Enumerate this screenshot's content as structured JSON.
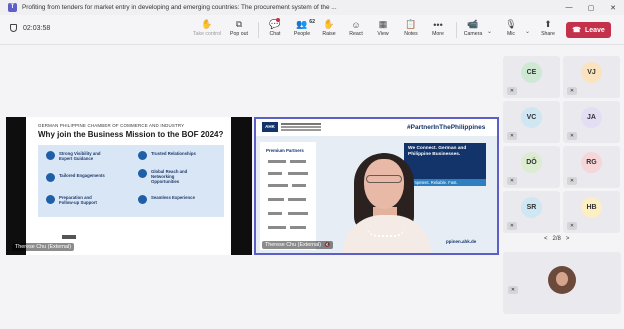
{
  "window": {
    "title": "Profiting from tenders for market entry in developing and emerging countries: The procurement system of the ...",
    "more": "...",
    "controls": [
      "—",
      "▢",
      "✕"
    ]
  },
  "toolbar": {
    "timer": "02:03:58",
    "take_control": "Take control",
    "pop_out": "Pop out",
    "chat": "Chat",
    "people": "People",
    "people_count": "62",
    "raise": "Raise",
    "react": "React",
    "view": "View",
    "notes": "Notes",
    "more": "More",
    "camera": "Camera",
    "mic": "Mic",
    "share": "Share",
    "leave": "Leave"
  },
  "left_tile": {
    "slide_org": "GERMAN PHILIPPINE CHAMBER OF COMMERCE AND INDUSTRY",
    "slide_title": "Why join the Business Mission to the BOF 2024?",
    "features": [
      "Strong Visibility and Expert Guidance",
      "Trusted Relationships",
      "Tailored Engagements",
      "Global Reach and Networking Opportunities",
      "Preparation and Follow-up Support",
      "Seamless Experience"
    ],
    "name_label": "Therese Chu (External)"
  },
  "right_tile": {
    "ahk": "AHK",
    "partner_brand": "#PartnerInThePhilippines",
    "premium_partners": "Premium Partners",
    "connect_text": "We Connect. German and Philippine Businesses.",
    "connect_sub": "Competent. Reliable. Fast.",
    "url": "ppinen.ahk.de",
    "name_label": "Therese Chu (External)"
  },
  "participants": [
    {
      "initials": "CE",
      "color": "#cfe8d4"
    },
    {
      "initials": "VJ",
      "color": "#fbe3c0"
    },
    {
      "initials": "VC",
      "color": "#cfe6f3"
    },
    {
      "initials": "JA",
      "color": "#e4def4"
    },
    {
      "initials": "DÖ",
      "color": "#dbecd1"
    },
    {
      "initials": "RG",
      "color": "#f6d6d9"
    },
    {
      "initials": "SR",
      "color": "#cfe6f3"
    },
    {
      "initials": "HB",
      "color": "#fbefc3"
    }
  ],
  "pager": {
    "prev": "<",
    "label": "2/8",
    "next": ">"
  },
  "colors": {
    "accent": "#5b5fc7",
    "leave": "#c4314b",
    "navy": "#12346b"
  }
}
